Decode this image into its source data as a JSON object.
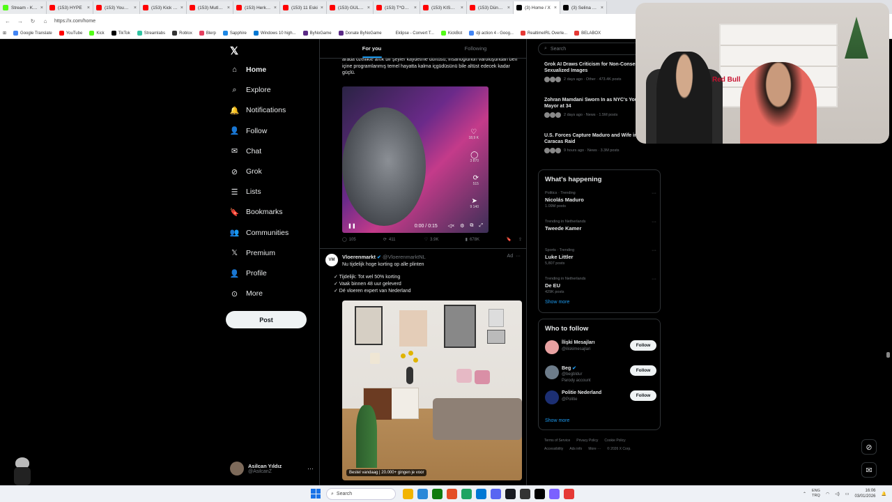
{
  "browser": {
    "tabs": [
      {
        "label": "Stream - Kick",
        "color": "#53fc18"
      },
      {
        "label": "(153) HYPE",
        "color": "#ff0000"
      },
      {
        "label": "(153) YouTube",
        "color": "#ff0000"
      },
      {
        "label": "(153) Kick Kon",
        "color": "#ff0000"
      },
      {
        "label": "(153) Mutlu Yı",
        "color": "#ff0000"
      },
      {
        "label": "(153) Herkese",
        "color": "#ff0000"
      },
      {
        "label": "(153) 11 Eski",
        "color": "#ff0000"
      },
      {
        "label": "(153) GÜLERS",
        "color": "#ff0000"
      },
      {
        "label": "(153) T*OZ İÇ",
        "color": "#ff0000"
      },
      {
        "label": "(153) KISACA",
        "color": "#ff0000"
      },
      {
        "label": "(153) Dünyan",
        "color": "#ff0000"
      },
      {
        "label": "(3) Home / X",
        "color": "#000000",
        "active": true
      },
      {
        "label": "(3) Selina Sayin",
        "color": "#000000"
      }
    ],
    "url": "https://x.com/home",
    "bookmarks": [
      {
        "label": "Google Translate",
        "color": "#4285f4"
      },
      {
        "label": "YouTube",
        "color": "#ff0000"
      },
      {
        "label": "Kick",
        "color": "#53fc18"
      },
      {
        "label": "TikTok",
        "color": "#000000"
      },
      {
        "label": "Streamlabs",
        "color": "#31c3a2"
      },
      {
        "label": "Roblox",
        "color": "#333333"
      },
      {
        "label": "Blerp",
        "color": "#e4405f"
      },
      {
        "label": "Sapphire",
        "color": "#1e88e5"
      },
      {
        "label": "Windows 10 high...",
        "color": "#0078d4"
      },
      {
        "label": "ByNoGame",
        "color": "#5b2a86"
      },
      {
        "label": "Donate ByNoGame",
        "color": "#5b2a86"
      },
      {
        "label": "Eklipse - Convert T...",
        "color": "#ffffff"
      },
      {
        "label": "KickBot",
        "color": "#53fc18"
      },
      {
        "label": "dji action 4 - Goog...",
        "color": "#4285f4"
      },
      {
        "label": "RealtimeIRL Overle...",
        "color": "#e53935"
      },
      {
        "label": "BELABOX",
        "color": "#e53935"
      }
    ]
  },
  "nav": {
    "items": [
      {
        "label": "Home",
        "icon": "⌂",
        "icon_name": "home-icon",
        "active": true
      },
      {
        "label": "Explore",
        "icon": "⌕",
        "icon_name": "search-icon"
      },
      {
        "label": "Notifications",
        "icon": "🔔",
        "icon_name": "bell-icon"
      },
      {
        "label": "Follow",
        "icon": "👤",
        "icon_name": "follow-icon"
      },
      {
        "label": "Chat",
        "icon": "✉",
        "icon_name": "chat-icon"
      },
      {
        "label": "Grok",
        "icon": "⊘",
        "icon_name": "grok-icon"
      },
      {
        "label": "Lists",
        "icon": "☰",
        "icon_name": "lists-icon"
      },
      {
        "label": "Bookmarks",
        "icon": "🔖",
        "icon_name": "bookmark-icon"
      },
      {
        "label": "Communities",
        "icon": "👥",
        "icon_name": "communities-icon"
      },
      {
        "label": "Premium",
        "icon": "𝕏",
        "icon_name": "premium-icon"
      },
      {
        "label": "Profile",
        "icon": "👤",
        "icon_name": "profile-icon"
      },
      {
        "label": "More",
        "icon": "⊙",
        "icon_name": "more-icon"
      }
    ],
    "post_label": "Post",
    "account": {
      "name": "Asilcan Yıldız",
      "handle": "@AsilcanZ"
    }
  },
  "timeline": {
    "tabs": [
      {
        "label": "For you",
        "active": true
      },
      {
        "label": "Following"
      }
    ],
    "tweet": {
      "text": "arada özellikle artık bir şeyler kaydetme dürtüsü, insanoğlunun varoluşundan beri içine programlanmış temel hayatta kalma içgüdüsünü bile altüst edecek kadar güçlü.",
      "video": {
        "time": "0:00 / 0:15",
        "likes": "18,9 K",
        "comments": "3 870",
        "reposts": "515",
        "shares": "9 140"
      },
      "actions": {
        "replies": "105",
        "reposts": "411",
        "likes": "3.9K",
        "views": "678K"
      }
    },
    "ad": {
      "logo_text": "VM",
      "name": "Vloerenmarkt",
      "handle": "@VloerenmarktNL",
      "tag": "Ad",
      "lines": [
        "Nu tijdelijk hoge korting op alle plinten",
        "",
        "✓ Tijdelijk: Tot wel 50% korting",
        "✓ Vaak binnen 48 uur geleverd",
        "✓ Dé vloeren expert van Nederland"
      ],
      "caption": "Bestel vandaag | 20.000+ gingen je voor"
    }
  },
  "right": {
    "search_placeholder": "Search",
    "news": [
      {
        "title": "Grok AI Draws Criticism for Non-Consensual Sexualized Images",
        "meta": "2 days ago · Other · 473.4K posts"
      },
      {
        "title": "Zohran Mamdani Sworn In as NYC's Youngest Mayor at 34",
        "meta": "2 days ago · News · 1.5M posts"
      },
      {
        "title": "U.S. Forces Capture Maduro and Wife in Caracas Raid",
        "meta": "9 hours ago · News · 3.3M posts"
      }
    ],
    "happening_title": "What's happening",
    "trends": [
      {
        "context": "Politics · Trending",
        "name": "Nicolás Maduro",
        "posts": "1.09M posts"
      },
      {
        "context": "Trending in Netherlands",
        "name": "Tweede Kamer",
        "posts": ""
      },
      {
        "context": "Sports · Trending",
        "name": "Luke Littler",
        "posts": "5,807 posts"
      },
      {
        "context": "Trending in Netherlands",
        "name": "De EU",
        "posts": "429K posts"
      }
    ],
    "show_more": "Show more",
    "wtf_title": "Who to follow",
    "who_to_follow": [
      {
        "name": "İlişki Mesajları",
        "handle": "@iliskimesajlari",
        "extra": "",
        "color": "#e8a1a1",
        "verified": false
      },
      {
        "name": "Beg",
        "handle": "@begbldur",
        "extra": "Parody account",
        "color": "#6d7c8a",
        "verified": true
      },
      {
        "name": "Politie Nederland",
        "handle": "@Politie",
        "extra": "",
        "color": "#1c2f73",
        "verified": false
      }
    ],
    "follow_label": "Follow",
    "footer": [
      "Terms of Service",
      "Privacy Policy",
      "Cookie Policy",
      "Accessibility",
      "Ads info",
      "More ···",
      "© 2026 X Corp."
    ]
  },
  "webcam": {
    "sign": "Red Bull"
  },
  "taskbar": {
    "search": "Search",
    "lang": "ENG",
    "lang2": "TRQ",
    "time": "16:06",
    "date": "03/01/2026",
    "apps": [
      "#f2b400",
      "#2b88d8",
      "#0f7b0f",
      "#e44d26",
      "#1fa463",
      "#0078d4",
      "#5865f2",
      "#171a21",
      "#333333",
      "#000000",
      "#7b61ff",
      "#e53935"
    ]
  }
}
